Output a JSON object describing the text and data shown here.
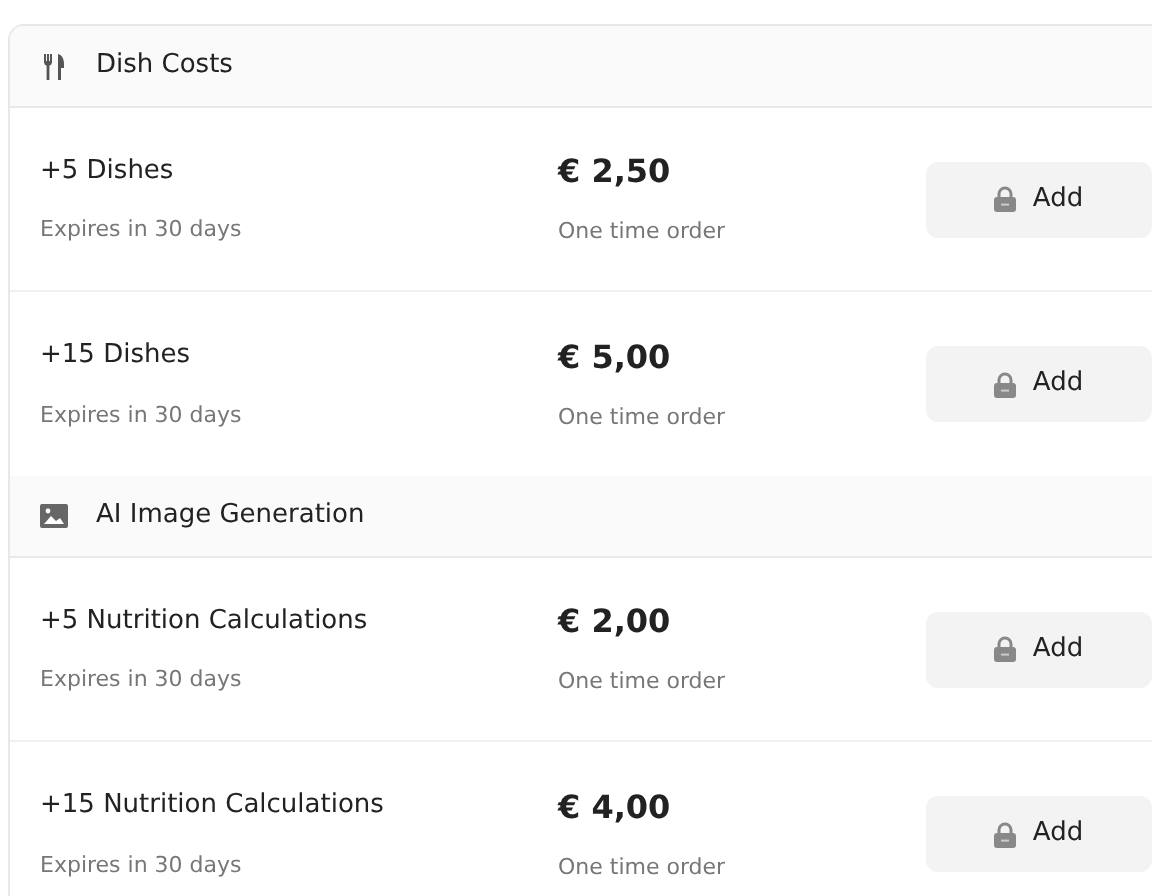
{
  "sections": [
    {
      "kind": "utensils",
      "title": "Dish Costs",
      "items": [
        {
          "name": "+5 Dishes",
          "expiry": "Expires in 30 days",
          "price": "€ 2,50",
          "note": "One time order",
          "button": "Add"
        },
        {
          "name": "+15 Dishes",
          "expiry": "Expires in 30 days",
          "price": "€ 5,00",
          "note": "One time order",
          "button": "Add"
        }
      ]
    },
    {
      "kind": "image",
      "title": "AI Image Generation",
      "items": [
        {
          "name": "+5 Nutrition Calculations",
          "expiry": "Expires in 30 days",
          "price": "€ 2,00",
          "note": "One time order",
          "button": "Add"
        },
        {
          "name": "+15 Nutrition Calculations",
          "expiry": "Expires in 30 days",
          "price": "€ 4,00",
          "note": "One time order",
          "button": "Add"
        }
      ]
    }
  ]
}
